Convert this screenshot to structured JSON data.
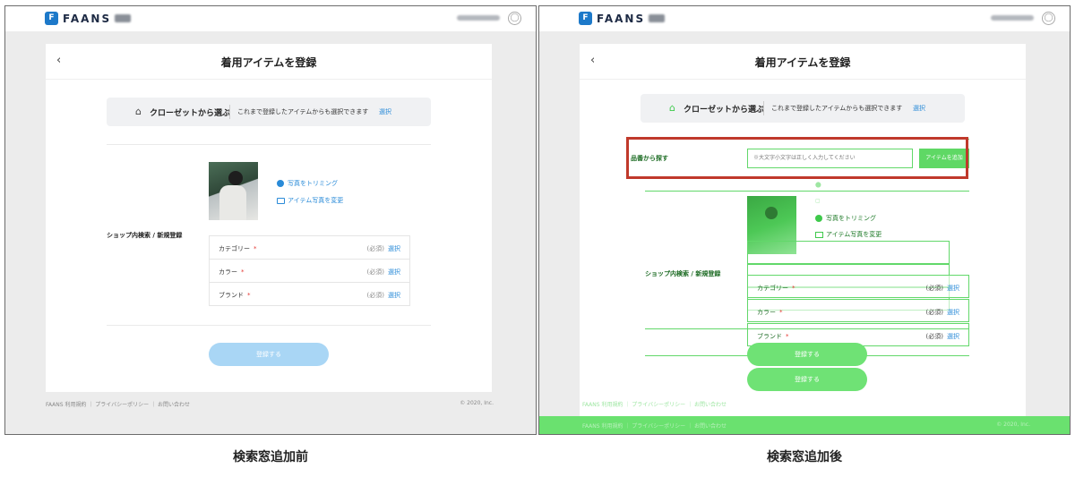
{
  "header": {
    "logo_text": "FAANS",
    "logo_mark": "F",
    "user_icon": "user-icon"
  },
  "before": {
    "back_label": "‹",
    "title": "着用アイテムを登録",
    "closet": {
      "icon": "hanger-icon",
      "label": "クローゼットから選ぶ",
      "description": "これまで登録したアイテムからも選択できます",
      "select_label": "選択"
    },
    "photo_actions": {
      "trim_label": "写真をトリミング",
      "change_label": "アイテム写真を変更"
    },
    "section_label": "ショップ内検索 / 新規登録",
    "attributes": [
      {
        "name": "カテゴリー",
        "required_mark": "*",
        "required_text": "(必須)",
        "select_label": "選択"
      },
      {
        "name": "カラー",
        "required_mark": "*",
        "required_text": "(必須)",
        "select_label": "選択"
      },
      {
        "name": "ブランド",
        "required_mark": "*",
        "required_text": "(必須)",
        "select_label": "選択"
      }
    ],
    "submit_label": "登録する",
    "footer": {
      "links": "FAANS 利用規約 ｜ プライバシーポリシー ｜ お問い合わせ",
      "copyright": "© 2020, Inc."
    }
  },
  "after": {
    "back_label": "‹",
    "title": "着用アイテムを登録",
    "closet": {
      "icon": "hanger-icon",
      "label": "クローゼットから選ぶ",
      "description": "これまで登録したアイテムからも選択できます",
      "select_label": "選択"
    },
    "search": {
      "label": "品番から探す",
      "placeholder": "※大文字小文字は正しく入力してください",
      "button_label": "アイテムを追加"
    },
    "photo_actions": {
      "trim_label": "写真をトリミング",
      "change_label": "アイテム写真を変更"
    },
    "section_label": "ショップ内検索 / 新規登録",
    "attributes": [
      {
        "name": "カテゴリー",
        "required_mark": "*",
        "required_text": "(必須)",
        "select_label": "選択"
      },
      {
        "name": "カラー",
        "required_mark": "*",
        "required_text": "(必須)",
        "select_label": "選択"
      },
      {
        "name": "ブランド",
        "required_mark": "*",
        "required_text": "(必須)",
        "select_label": "選択"
      }
    ],
    "submit_label": "登録する",
    "footer": {
      "links": "FAANS 利用規約 ｜ プライバシーポリシー ｜ お問い合わせ",
      "copyright": "© 2020, Inc."
    }
  },
  "captions": {
    "before": "検索窓追加前",
    "after": "検索窓追加後"
  },
  "colors": {
    "accent_blue": "#2a8bd8",
    "submit_disabled": "#a9d6f5",
    "overlay_green": "#6ae16f",
    "highlight_red": "#c0392b"
  }
}
